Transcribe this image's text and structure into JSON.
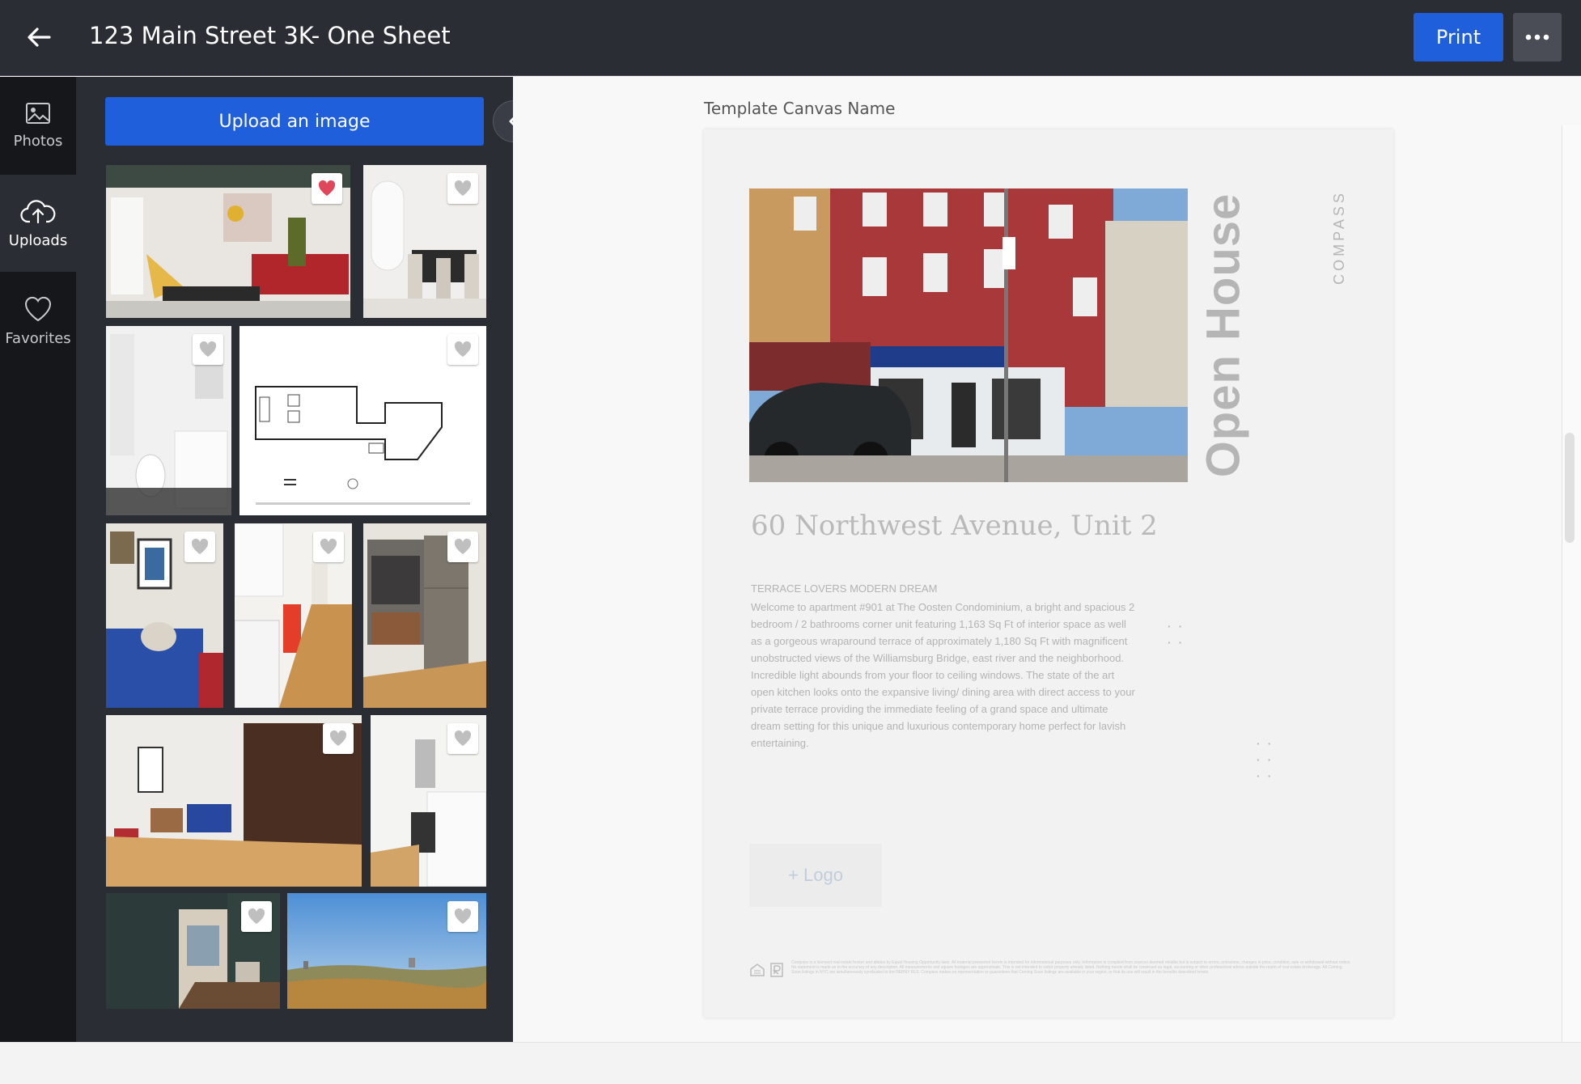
{
  "header": {
    "title": "123 Main Street 3K- One Sheet",
    "print_label": "Print"
  },
  "rail": {
    "items": [
      {
        "label": "Photos",
        "icon": "image-icon"
      },
      {
        "label": "Uploads",
        "icon": "cloud-upload-icon",
        "active": true
      },
      {
        "label": "Favorites",
        "icon": "heart-icon"
      }
    ]
  },
  "panel": {
    "upload_label": "Upload an image"
  },
  "canvas": {
    "name": "Template Canvas Name",
    "open_house": "Open House",
    "brand": "COMPASS",
    "address": "60 Northwest Avenue, Unit 2",
    "description_heading": "TERRACE LOVERS MODERN DREAM",
    "description_p1": "Welcome to apartment #901 at The Oosten Condominium, a bright and spacious 2 bedroom / 2 bathrooms corner unit featuring 1,163 Sq Ft of interior space as well as a gorgeous wraparound terrace of approximately 1,180 Sq Ft with magnificent unobstructed views of the Williamsburg Bridge, east river and the neighborhood.",
    "description_p2": "Incredible light abounds from your floor to ceiling windows. The state of the art open kitchen looks onto the expansive living/ dining area with direct access to your private terrace providing the immediate feeling of a grand space and ultimate dream setting for this unique and luxurious contemporary home perfect for lavish entertaining.",
    "logo_label": "+ Logo",
    "fine_print": "Compass is a licensed real estate broker and abides by Equal Housing Opportunity laws. All material presented herein is intended for informational purposes only. Information is compiled from sources deemed reliable but is subject to errors, omissions, changes in price, condition, sale or withdrawal without notice. No statement is made as to the accuracy of any description. All measurements and square footages are approximate. This is not intended to solicit property already listed. Nothing herein shall be construed as legal, accounting or other professional advice outside the realm of real estate brokerage. All Coming Soon listings in NYC are simultaneously syndicated to the REBNY RLS. Compass makes no representation or guarantees that Coming Soon listings are available in your region, or that its use will result in the benefits described herein."
  },
  "colors": {
    "accent": "#1f5fdc",
    "favorite_active": "#e0475b",
    "topbar": "#2a2d33"
  }
}
